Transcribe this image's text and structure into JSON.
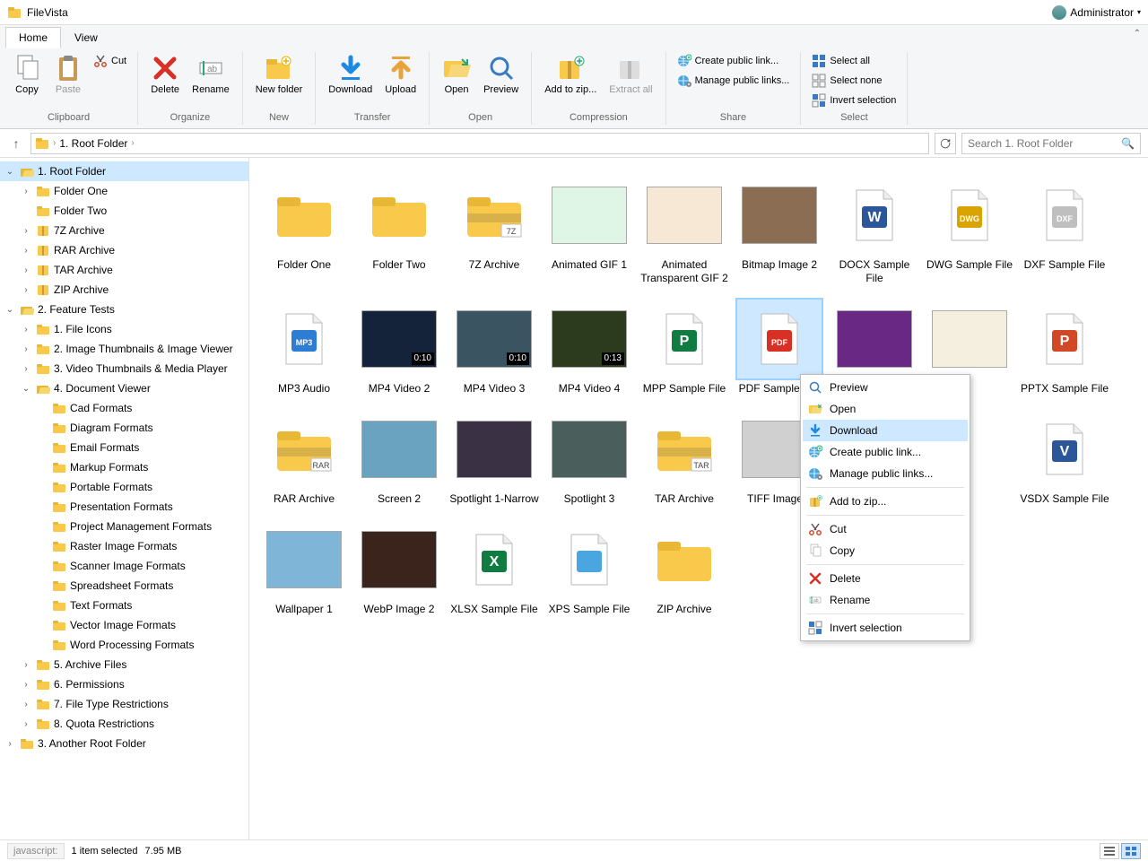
{
  "app": {
    "title": "FileVista"
  },
  "user": {
    "name": "Administrator"
  },
  "tabs": [
    {
      "id": "home",
      "label": "Home",
      "active": true
    },
    {
      "id": "view",
      "label": "View",
      "active": false
    }
  ],
  "ribbon": {
    "groups": [
      {
        "label": "Clipboard",
        "items": [
          {
            "id": "copy",
            "label": "Copy",
            "large": true,
            "icon": "copy"
          },
          {
            "id": "paste",
            "label": "Paste",
            "large": true,
            "icon": "paste",
            "disabled": true
          },
          {
            "id": "cut",
            "label": "Cut",
            "small": true,
            "icon": "cut"
          }
        ]
      },
      {
        "label": "Organize",
        "items": [
          {
            "id": "delete",
            "label": "Delete",
            "large": true,
            "icon": "delete"
          },
          {
            "id": "rename",
            "label": "Rename",
            "large": true,
            "icon": "rename"
          }
        ]
      },
      {
        "label": "New",
        "items": [
          {
            "id": "newfolder",
            "label": "New folder",
            "large": true,
            "icon": "newfolder"
          }
        ]
      },
      {
        "label": "Transfer",
        "items": [
          {
            "id": "download",
            "label": "Download",
            "large": true,
            "icon": "download"
          },
          {
            "id": "upload",
            "label": "Upload",
            "large": true,
            "icon": "upload"
          }
        ]
      },
      {
        "label": "Open",
        "items": [
          {
            "id": "open",
            "label": "Open",
            "large": true,
            "icon": "open"
          },
          {
            "id": "preview",
            "label": "Preview",
            "large": true,
            "icon": "preview"
          }
        ]
      },
      {
        "label": "Compression",
        "items": [
          {
            "id": "addzip",
            "label": "Add to zip...",
            "large": true,
            "icon": "addzip"
          },
          {
            "id": "extract",
            "label": "Extract all",
            "large": true,
            "icon": "extract",
            "disabled": true
          }
        ]
      },
      {
        "label": "Share",
        "items": [
          {
            "id": "createpublic",
            "label": "Create public link...",
            "small": true,
            "icon": "globe-plus"
          },
          {
            "id": "managepublic",
            "label": "Manage public links...",
            "small": true,
            "icon": "globe-gear"
          }
        ]
      },
      {
        "label": "Select",
        "items": [
          {
            "id": "selall",
            "label": "Select all",
            "small": true,
            "icon": "sel-all"
          },
          {
            "id": "selnone",
            "label": "Select none",
            "small": true,
            "icon": "sel-none"
          },
          {
            "id": "selinv",
            "label": "Invert selection",
            "small": true,
            "icon": "sel-invert"
          }
        ]
      }
    ]
  },
  "breadcrumb": {
    "root_label": "1. Root Folder"
  },
  "search": {
    "placeholder": "Search 1. Root Folder"
  },
  "tree": [
    {
      "indent": 0,
      "label": "1. Root Folder",
      "exp": "open",
      "selected": true,
      "icon": "folder-open"
    },
    {
      "indent": 1,
      "label": "Folder One",
      "exp": "closed",
      "icon": "folder"
    },
    {
      "indent": 1,
      "label": "Folder Two",
      "exp": "none",
      "icon": "folder"
    },
    {
      "indent": 1,
      "label": "7Z Archive",
      "exp": "closed",
      "icon": "zip"
    },
    {
      "indent": 1,
      "label": "RAR Archive",
      "exp": "closed",
      "icon": "zip"
    },
    {
      "indent": 1,
      "label": "TAR Archive",
      "exp": "closed",
      "icon": "zip"
    },
    {
      "indent": 1,
      "label": "ZIP Archive",
      "exp": "closed",
      "icon": "zip"
    },
    {
      "indent": 0,
      "label": "2. Feature Tests",
      "exp": "open",
      "icon": "folder-open"
    },
    {
      "indent": 1,
      "label": "1. File Icons",
      "exp": "closed",
      "icon": "folder"
    },
    {
      "indent": 1,
      "label": "2. Image Thumbnails & Image Viewer",
      "exp": "closed",
      "icon": "folder"
    },
    {
      "indent": 1,
      "label": "3. Video Thumbnails & Media Player",
      "exp": "closed",
      "icon": "folder"
    },
    {
      "indent": 1,
      "label": "4. Document Viewer",
      "exp": "open",
      "icon": "folder-open"
    },
    {
      "indent": 2,
      "label": "Cad Formats",
      "exp": "none",
      "icon": "folder"
    },
    {
      "indent": 2,
      "label": "Diagram Formats",
      "exp": "none",
      "icon": "folder"
    },
    {
      "indent": 2,
      "label": "Email Formats",
      "exp": "none",
      "icon": "folder"
    },
    {
      "indent": 2,
      "label": "Markup Formats",
      "exp": "none",
      "icon": "folder"
    },
    {
      "indent": 2,
      "label": "Portable Formats",
      "exp": "none",
      "icon": "folder"
    },
    {
      "indent": 2,
      "label": "Presentation Formats",
      "exp": "none",
      "icon": "folder"
    },
    {
      "indent": 2,
      "label": "Project Management Formats",
      "exp": "none",
      "icon": "folder"
    },
    {
      "indent": 2,
      "label": "Raster Image Formats",
      "exp": "none",
      "icon": "folder"
    },
    {
      "indent": 2,
      "label": "Scanner Image Formats",
      "exp": "none",
      "icon": "folder"
    },
    {
      "indent": 2,
      "label": "Spreadsheet Formats",
      "exp": "none",
      "icon": "folder"
    },
    {
      "indent": 2,
      "label": "Text Formats",
      "exp": "none",
      "icon": "folder"
    },
    {
      "indent": 2,
      "label": "Vector Image Formats",
      "exp": "none",
      "icon": "folder"
    },
    {
      "indent": 2,
      "label": "Word Processing Formats",
      "exp": "none",
      "icon": "folder"
    },
    {
      "indent": 1,
      "label": "5. Archive Files",
      "exp": "closed",
      "icon": "folder"
    },
    {
      "indent": 1,
      "label": "6. Permissions",
      "exp": "closed",
      "icon": "folder"
    },
    {
      "indent": 1,
      "label": "7. File Type Restrictions",
      "exp": "closed",
      "icon": "folder"
    },
    {
      "indent": 1,
      "label": "8. Quota Restrictions",
      "exp": "closed",
      "icon": "folder"
    },
    {
      "indent": 0,
      "label": "3. Another Root Folder",
      "exp": "closed",
      "icon": "folder"
    }
  ],
  "items": [
    {
      "label": "Folder One",
      "type": "folder"
    },
    {
      "label": "Folder Two",
      "type": "folder"
    },
    {
      "label": "7Z Archive",
      "type": "zipfolder",
      "badge": "7Z"
    },
    {
      "label": "Animated GIF 1",
      "type": "image",
      "bg": "#dff5e6"
    },
    {
      "label": "Animated Transparent GIF 2",
      "type": "image",
      "bg": "#f7e8d6"
    },
    {
      "label": "Bitmap Image 2",
      "type": "image",
      "bg": "#8a6d52"
    },
    {
      "label": "DOCX Sample File",
      "type": "doc",
      "color": "#2b579a",
      "letter": "W"
    },
    {
      "label": "DWG Sample File",
      "type": "doc",
      "color": "#d9a400",
      "letter": "DWG"
    },
    {
      "label": "DXF Sample File",
      "type": "doc",
      "color": "#bfbfbf",
      "letter": "DXF"
    },
    {
      "label": "MP3 Audio",
      "type": "doc",
      "color": "#2e7dd4",
      "letter": "MP3"
    },
    {
      "label": "MP4 Video 2",
      "type": "video",
      "duration": "0:10",
      "bg": "#14233a"
    },
    {
      "label": "MP4 Video 3",
      "type": "video",
      "duration": "0:10",
      "bg": "#3a5561"
    },
    {
      "label": "MP4 Video 4",
      "type": "video",
      "duration": "0:13",
      "bg": "#2c3b1d"
    },
    {
      "label": "MPP Sample File",
      "type": "doc",
      "color": "#107c41",
      "letter": "P"
    },
    {
      "label": "PDF Sample File",
      "type": "doc",
      "color": "#d93025",
      "letter": "PDF",
      "selected": true
    },
    {
      "label": "",
      "type": "image",
      "bg": "#6a2885"
    },
    {
      "label": "",
      "type": "image",
      "bg": "#f5efe0"
    },
    {
      "label": "PPTX Sample File",
      "type": "doc",
      "color": "#d24726",
      "letter": "P"
    },
    {
      "label": "RAR Archive",
      "type": "zipfolder",
      "badge": "RAR"
    },
    {
      "label": "Screen 2",
      "type": "image",
      "bg": "#6aa3bf"
    },
    {
      "label": "Spotlight 1-Narrow",
      "type": "image",
      "bg": "#3a3244"
    },
    {
      "label": "Spotlight 3",
      "type": "image",
      "bg": "#4a5e5b"
    },
    {
      "label": "TAR Archive",
      "type": "zipfolder",
      "badge": "TAR"
    },
    {
      "label": "TIFF Image 4",
      "type": "image",
      "bg": "#d0d0d0"
    },
    {
      "label": "",
      "type": "hidden"
    },
    {
      "label": "",
      "type": "hidden"
    },
    {
      "label": "VSDX Sample File",
      "type": "doc",
      "color": "#2b579a",
      "letter": "V"
    },
    {
      "label": "Wallpaper 1",
      "type": "image",
      "bg": "#7fb6d7"
    },
    {
      "label": "WebP Image 2",
      "type": "image",
      "bg": "#3a241b"
    },
    {
      "label": "XLSX Sample File",
      "type": "doc",
      "color": "#107c41",
      "letter": "X"
    },
    {
      "label": "XPS Sample File",
      "type": "doc",
      "color": "#4aa6e0",
      "letter": ""
    },
    {
      "label": "ZIP Archive",
      "type": "zipfolder",
      "badge": ""
    }
  ],
  "context_menu": {
    "items": [
      {
        "label": "Preview",
        "icon": "preview"
      },
      {
        "label": "Open",
        "icon": "open"
      },
      {
        "label": "Download",
        "icon": "download",
        "highlight": true
      },
      {
        "label": "Create public link...",
        "icon": "globe-plus"
      },
      {
        "label": "Manage public links...",
        "icon": "globe-gear"
      },
      {
        "sep": true
      },
      {
        "label": "Add to zip...",
        "icon": "addzip"
      },
      {
        "sep": true
      },
      {
        "label": "Cut",
        "icon": "cut"
      },
      {
        "label": "Copy",
        "icon": "copy"
      },
      {
        "sep": true
      },
      {
        "label": "Delete",
        "icon": "delete"
      },
      {
        "label": "Rename",
        "icon": "rename"
      },
      {
        "sep": true
      },
      {
        "label": "Invert selection",
        "icon": "sel-invert"
      }
    ]
  },
  "status": {
    "js": "javascript:",
    "selection": "1 item selected",
    "size": "7.95 MB"
  }
}
